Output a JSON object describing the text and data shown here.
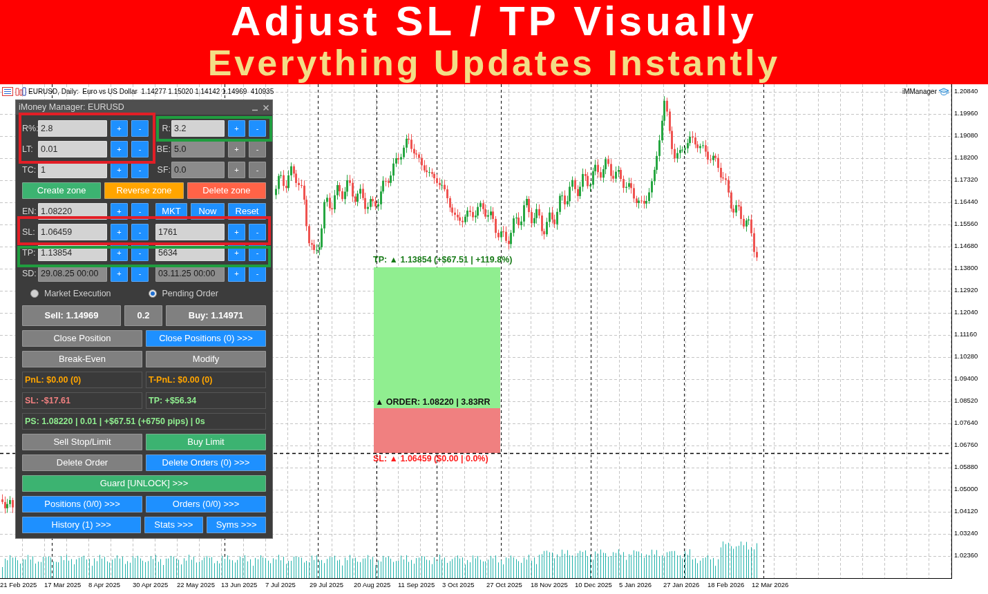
{
  "banner": {
    "title": "Adjust SL / TP Visually",
    "subtitle": "Everything Updates Instantly"
  },
  "chart": {
    "symbol_info": "EURUSD, Daily:  Euro vs US Dollar  1.14277 1.15020 1.14142 1.14969  410935",
    "indicator": "iMManager",
    "price_axis": [
      "1.20840",
      "1.19960",
      "1.19080",
      "1.18200",
      "1.17320",
      "1.16440",
      "1.15560",
      "1.14680",
      "1.13800",
      "1.12920",
      "1.12040",
      "1.11160",
      "1.10280",
      "1.09400",
      "1.08520",
      "1.07640",
      "1.06760",
      "1.05880",
      "1.05000",
      "1.04120",
      "1.03240",
      "1.02360"
    ],
    "date_axis": [
      "21 Feb 2025",
      "17 Mar 2025",
      "8 Apr 2025",
      "30 Apr 2025",
      "22 May 2025",
      "13 Jun 2025",
      "7 Jul 2025",
      "29 Jul 2025",
      "20 Aug 2025",
      "11 Sep 2025",
      "3 Oct 2025",
      "27 Oct 2025",
      "18 Nov 2025",
      "10 Dec 2025",
      "5 Jan 2026",
      "27 Jan 2026",
      "18 Feb 2026",
      "12 Mar 2026"
    ],
    "zone": {
      "tp_label": "TP: ▲ 1.13854 (+$67.51 | +119.8%)",
      "order_label": "▲ ORDER: 1.08220 | 3.83RR",
      "sl_label": "SL: ▲ 1.06459 ($0.00 | 0.0%)"
    }
  },
  "highlights": [
    {
      "color": "#e31e26"
    },
    {
      "color": "#1f9d3f"
    },
    {
      "color": "#e31e26"
    },
    {
      "color": "#1f9d3f"
    }
  ],
  "panel": {
    "title": "iMoney Manager: EURUSD",
    "rows": [
      {
        "kind": "fields",
        "left": {
          "label": "R%:",
          "value": "2.8",
          "disabled": false,
          "steppers": [
            "+",
            "-"
          ],
          "steppers_disabled": false
        },
        "right": {
          "label": "R:",
          "value": "3.2",
          "disabled": false,
          "steppers": [
            "+",
            "-"
          ],
          "steppers_disabled": false
        }
      },
      {
        "kind": "fields",
        "left": {
          "label": "LT:",
          "value": "0.01",
          "disabled": false,
          "steppers": [
            "+",
            "-"
          ],
          "steppers_disabled": false
        },
        "right": {
          "label": "BE:",
          "value": "5.0",
          "disabled": true,
          "steppers": [
            "+",
            "-"
          ],
          "steppers_disabled": true
        }
      },
      {
        "kind": "fields",
        "left": {
          "label": "TC:",
          "value": "1",
          "disabled": false,
          "steppers": [
            "+",
            "-"
          ],
          "steppers_disabled": false
        },
        "right": {
          "label": "SF:",
          "value": "0.0",
          "disabled": true,
          "steppers": [
            "+",
            "-"
          ],
          "steppers_disabled": true
        }
      },
      {
        "kind": "zone_buttons",
        "items": [
          {
            "label": "Create zone",
            "color": "#3cb371"
          },
          {
            "label": "Reverse zone",
            "color": "#ffa500"
          },
          {
            "label": "Delete zone",
            "color": "#ff6347"
          }
        ]
      },
      {
        "kind": "fields",
        "left": {
          "label": "EN:",
          "value": "1.08220",
          "disabled": false,
          "steppers": [
            "+",
            "-"
          ],
          "steppers_disabled": false
        },
        "right_buttons": [
          {
            "label": "MKT",
            "color": "#1e90ff"
          },
          {
            "label": "Now",
            "color": "#1e90ff"
          },
          {
            "label": "Reset",
            "color": "#1e90ff"
          }
        ]
      },
      {
        "kind": "fields",
        "left": {
          "label": "SL:",
          "value": "1.06459",
          "disabled": false,
          "steppers": [
            "+",
            "-"
          ],
          "steppers_disabled": false
        },
        "right": {
          "value": "1761",
          "disabled": false,
          "steppers": [
            "+",
            "-"
          ],
          "steppers_disabled": false
        }
      },
      {
        "kind": "fields",
        "left": {
          "label": "TP:",
          "value": "1.13854",
          "disabled": false,
          "steppers": [
            "+",
            "-"
          ],
          "steppers_disabled": false
        },
        "right": {
          "value": "5634",
          "disabled": false,
          "steppers": [
            "+",
            "-"
          ],
          "steppers_disabled": false
        }
      },
      {
        "kind": "fields",
        "left": {
          "label": "SD:",
          "value": "29.08.25 00:00",
          "disabled": true,
          "steppers": [
            "+",
            "-"
          ],
          "steppers_disabled": false
        },
        "right": {
          "value": "03.11.25 00:00",
          "disabled": true,
          "steppers": [
            "+",
            "-"
          ],
          "steppers_disabled": false
        }
      },
      {
        "kind": "radios",
        "options": [
          {
            "label": "Market Execution",
            "selected": false
          },
          {
            "label": "Pending Order",
            "selected": true
          }
        ]
      },
      {
        "kind": "trade",
        "items": [
          {
            "label": "Sell: 1.14969",
            "color": "#808080"
          },
          {
            "label": "0.2",
            "color": "#808080"
          },
          {
            "label": "Buy: 1.14971",
            "color": "#808080"
          }
        ]
      },
      {
        "kind": "buttons",
        "items": [
          {
            "label": "Close Position",
            "color": "#808080"
          },
          {
            "label": "Close Positions (0) >>>",
            "color": "#1e90ff"
          }
        ]
      },
      {
        "kind": "buttons",
        "items": [
          {
            "label": "Break-Even",
            "color": "#808080"
          },
          {
            "label": "Modify",
            "color": "#808080"
          }
        ]
      },
      {
        "kind": "readouts",
        "items": [
          {
            "text": "PnL: $0.00 (0)",
            "color": "#ffa500"
          },
          {
            "text": "T-PnL: $0.00 (0)",
            "color": "#ffa500"
          }
        ]
      },
      {
        "kind": "readouts",
        "items": [
          {
            "text": "SL: -$17.61",
            "color": "#f08080"
          },
          {
            "text": "TP: +$56.34",
            "color": "#90ee90"
          }
        ]
      },
      {
        "kind": "readouts",
        "items": [
          {
            "text": "PS: 1.08220 | 0.01 | +$67.51 (+6750 pips) | 0s",
            "color": "#90ee90"
          }
        ]
      },
      {
        "kind": "buttons",
        "items": [
          {
            "label": "Sell Stop/Limit",
            "color": "#808080"
          },
          {
            "label": "Buy Limit",
            "color": "#3cb371"
          }
        ]
      },
      {
        "kind": "buttons",
        "items": [
          {
            "label": "Delete Order",
            "color": "#808080"
          },
          {
            "label": "Delete Orders (0) >>>",
            "color": "#1e90ff"
          }
        ]
      },
      {
        "kind": "buttons",
        "items": [
          {
            "label": "Guard [UNLOCK] >>>",
            "color": "#3cb371"
          }
        ]
      },
      {
        "kind": "buttons",
        "items": [
          {
            "label": "Positions (0/0) >>>",
            "color": "#1e90ff"
          },
          {
            "label": "Orders (0/0) >>>",
            "color": "#1e90ff"
          }
        ]
      },
      {
        "kind": "buttons",
        "items": [
          {
            "label": "History (1) >>>",
            "color": "#1e90ff"
          },
          {
            "label": "Stats >>>",
            "color": "#1e90ff"
          },
          {
            "label": "Syms >>>",
            "color": "#1e90ff"
          }
        ]
      }
    ]
  }
}
